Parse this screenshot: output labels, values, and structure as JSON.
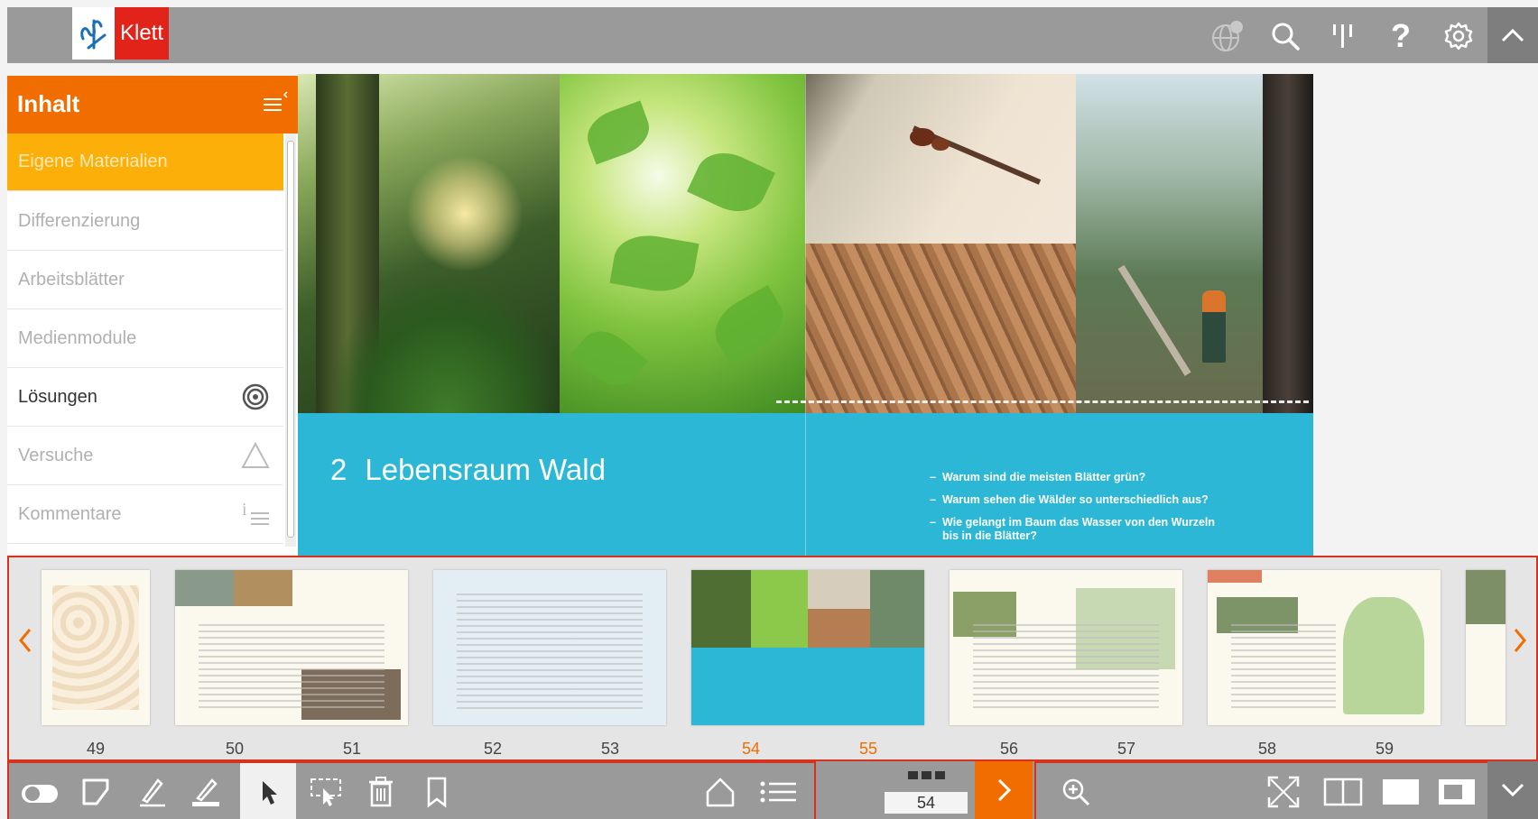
{
  "brand": {
    "logo_text": "Klett",
    "accent": "#f26d00",
    "teal": "#2bb7d5",
    "active_item": "#fcaf08",
    "red_highlight": "#d8321e"
  },
  "topbar": {
    "icons": [
      "globe-icon",
      "search-icon",
      "bookmark-bars-icon",
      "help-icon",
      "gear-icon",
      "chevron-up-icon"
    ]
  },
  "sidebar": {
    "title": "Inhalt",
    "items": [
      {
        "label": "Eigene Materialien",
        "state": "active"
      },
      {
        "label": "Differenzierung",
        "state": "disabled"
      },
      {
        "label": "Arbeitsblätter",
        "state": "disabled"
      },
      {
        "label": "Medienmodule",
        "state": "disabled"
      },
      {
        "label": "Lösungen",
        "state": "enabled",
        "icon": "target-icon"
      },
      {
        "label": "Versuche",
        "state": "disabled",
        "icon": "triangle-icon"
      },
      {
        "label": "Kommentare",
        "state": "disabled",
        "icon": "info-list-icon"
      }
    ]
  },
  "spread": {
    "chapter_number": "2",
    "chapter_title": "Lebensraum Wald",
    "questions": [
      "Warum sind die meisten Blätter grün?",
      "Warum sehen die Wälder so unterschiedlich aus?",
      "Wie gelangt im Baum das Wasser von den Wurzeln bis in die Blätter?"
    ]
  },
  "thumbnails": {
    "pages": [
      "49",
      "50",
      "51",
      "52",
      "53",
      "54",
      "55",
      "56",
      "57",
      "58",
      "59"
    ],
    "current_pages": [
      "54",
      "55"
    ]
  },
  "toolbar": {
    "current_page": "54",
    "icons_left": [
      "toggle-icon",
      "tablet-icon",
      "pen-icon",
      "highlighter-icon",
      "pointer-icon",
      "selection-icon",
      "trash-icon",
      "bookmark-icon",
      "home-icon",
      "list-icon"
    ],
    "icons_right": [
      "zoom-in-icon",
      "fullscreen-icon",
      "double-page-icon",
      "single-page-icon",
      "page-fit-icon",
      "chevron-down-icon"
    ]
  }
}
